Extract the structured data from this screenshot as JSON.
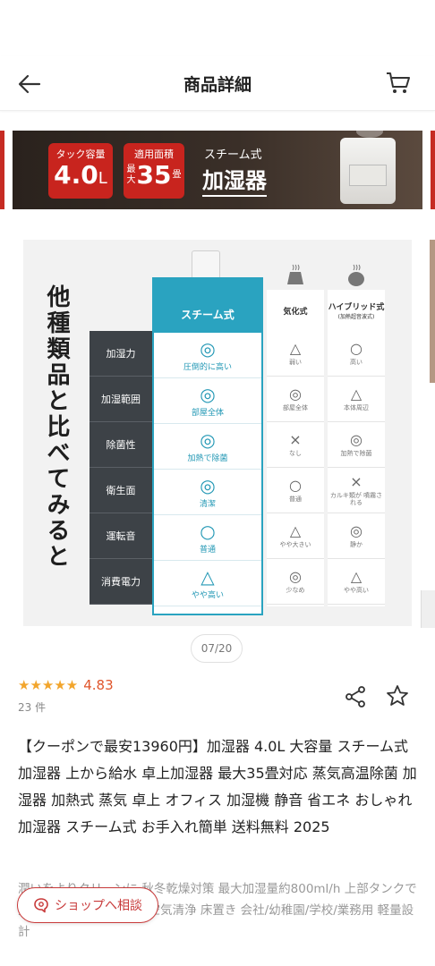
{
  "header": {
    "title": "商品詳細"
  },
  "banner": {
    "badge1": {
      "caption": "タック容量",
      "value": "4.0",
      "unit": "L"
    },
    "badge2": {
      "caption": "適用面積",
      "prefix": "最大",
      "value": "35",
      "unit": "畳"
    },
    "type_caption": "スチーム式",
    "type_main": "加湿器"
  },
  "comparison": {
    "side_text": "他種類品と比べてみると",
    "row_labels": [
      "加湿力",
      "加湿範囲",
      "除菌性",
      "衛生面",
      "運転音",
      "消費電力"
    ],
    "main_column": {
      "header": "スチーム式",
      "cells": [
        {
          "symbol": "◎",
          "note": "圧倒的に高い"
        },
        {
          "symbol": "◎",
          "note": "部屋全体"
        },
        {
          "symbol": "◎",
          "note": "加熱で除菌"
        },
        {
          "symbol": "◎",
          "note": "清潔"
        },
        {
          "symbol": "○",
          "note": "普通"
        },
        {
          "symbol": "△",
          "note": "やや高い"
        }
      ]
    },
    "column_1": {
      "header": "気化式",
      "cells": [
        {
          "symbol": "△",
          "note": "弱い"
        },
        {
          "symbol": "◎",
          "note": "部屋全体"
        },
        {
          "symbol": "×",
          "note": "なし"
        },
        {
          "symbol": "○",
          "note": "普通"
        },
        {
          "symbol": "△",
          "note": "やや大きい"
        },
        {
          "symbol": "◎",
          "note": "少なめ"
        }
      ]
    },
    "column_2": {
      "header": "ハイブリッド式",
      "header_sub": "(加熱超音波式)",
      "cells": [
        {
          "symbol": "○",
          "note": "高い"
        },
        {
          "symbol": "△",
          "note": "本体周辺"
        },
        {
          "symbol": "◎",
          "note": "加熱で除菌"
        },
        {
          "symbol": "×",
          "note": "カルキ類が 噴霧される"
        },
        {
          "symbol": "◎",
          "note": "静か"
        },
        {
          "symbol": "△",
          "note": "やや高い"
        }
      ]
    }
  },
  "gallery": {
    "counter": "07/20"
  },
  "rating": {
    "stars": "★★★★★",
    "score": "4.83",
    "count": "23 件"
  },
  "product": {
    "title": "【クーポンで最安13960円】加湿器 4.0L 大容量 スチーム式加湿器 上から給水 卓上加湿器 最大35畳対応 蒸気高温除菌 加湿器 加熱式 蒸気 卓上 オフィス 加湿機 静音 省エネ おしゃれ 加湿器 スチーム式 お手入れ簡単 送料無料 2025",
    "description": "潤いをよりクリーンに 秋冬乾燥対策 最大加湿量約800ml/h 上部タンクで大容量4.0L 上から給水 空気清浄 床置き 会社/幼稚園/学校/業務用 軽量設計"
  },
  "shop_button": {
    "label": "ショップへ相談"
  },
  "colors": {
    "accent_red": "#c83a3a",
    "star": "#f2a52c",
    "score": "#e0552b",
    "steam_blue": "#2aa3c0"
  }
}
